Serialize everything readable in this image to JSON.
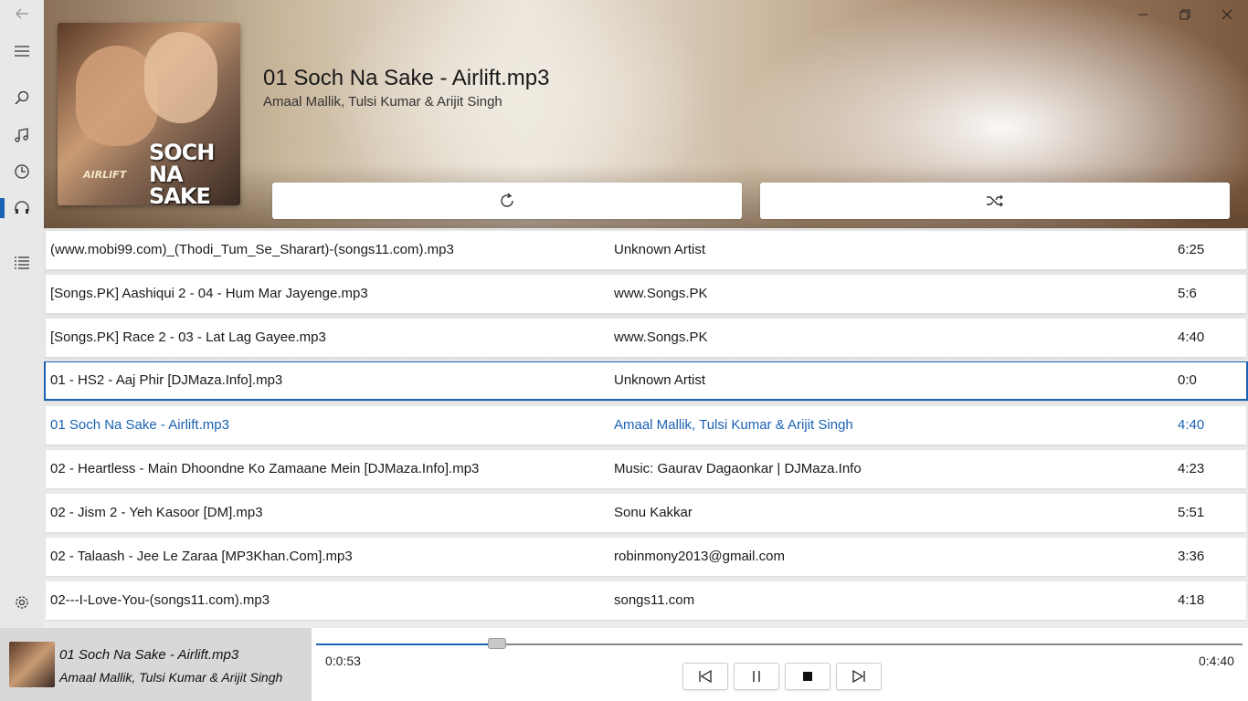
{
  "window": {
    "controls": [
      "minimize",
      "maximize",
      "close"
    ]
  },
  "nav": {
    "items": [
      {
        "name": "back",
        "icon": "back-arrow-icon"
      },
      {
        "name": "menu",
        "icon": "hamburger-icon"
      },
      {
        "name": "search",
        "icon": "search-icon"
      },
      {
        "name": "music",
        "icon": "music-note-icon"
      },
      {
        "name": "recent",
        "icon": "clock-icon"
      },
      {
        "name": "now-playing",
        "icon": "headphones-icon",
        "active": true
      },
      {
        "name": "playlist",
        "icon": "list-icon"
      },
      {
        "name": "settings",
        "icon": "gear-icon"
      }
    ],
    "accent": "#1a62b3"
  },
  "header": {
    "album_art_text": "SOCH NA SAKE",
    "album_art_small": "AIRLIFT",
    "title": "01 Soch Na Sake - Airlift.mp3",
    "artist": "Amaal Mallik, Tulsi Kumar & Arijit Singh",
    "repeat_icon": "repeat-icon",
    "shuffle_icon": "shuffle-icon"
  },
  "songs": [
    {
      "title": "(www.mobi99.com)_(Thodi_Tum_Se_Sharart)-(songs11.com).mp3",
      "artist": "Unknown Artist",
      "duration": "6:25"
    },
    {
      "title": "[Songs.PK] Aashiqui 2 - 04 - Hum Mar Jayenge.mp3",
      "artist": "www.Songs.PK",
      "duration": "5:6"
    },
    {
      "title": "[Songs.PK] Race 2 - 03 - Lat Lag Gayee.mp3",
      "artist": "www.Songs.PK",
      "duration": "4:40"
    },
    {
      "title": "01 - HS2 - Aaj Phir [DJMaza.Info].mp3",
      "artist": "Unknown Artist",
      "duration": "0:0",
      "selected": true
    },
    {
      "title": "01 Soch Na Sake - Airlift.mp3",
      "artist": "Amaal Mallik, Tulsi Kumar & Arijit Singh",
      "duration": "4:40",
      "playing": true
    },
    {
      "title": "02 - Heartless - Main Dhoondne Ko Zamaane Mein [DJMaza.Info].mp3",
      "artist": "Music: Gaurav Dagaonkar | DJMaza.Info",
      "duration": "4:23"
    },
    {
      "title": "02 - Jism 2 - Yeh Kasoor [DM].mp3",
      "artist": "Sonu Kakkar",
      "duration": "5:51"
    },
    {
      "title": "02 - Talaash - Jee Le Zaraa [MP3Khan.Com].mp3",
      "artist": "robinmony2013@gmail.com",
      "duration": "3:36"
    },
    {
      "title": "02---I-Love-You-(songs11.com).mp3",
      "artist": "songs11.com",
      "duration": "4:18"
    }
  ],
  "player": {
    "now_playing_title": "01 Soch Na Sake - Airlift.mp3",
    "now_playing_artist": "Amaal Mallik, Tulsi Kumar & Arijit Singh",
    "current_time": "0:0:53",
    "total_time": "0:4:40",
    "progress": 0.195,
    "controls": [
      "previous-icon",
      "pause-icon",
      "stop-icon",
      "next-icon"
    ]
  }
}
